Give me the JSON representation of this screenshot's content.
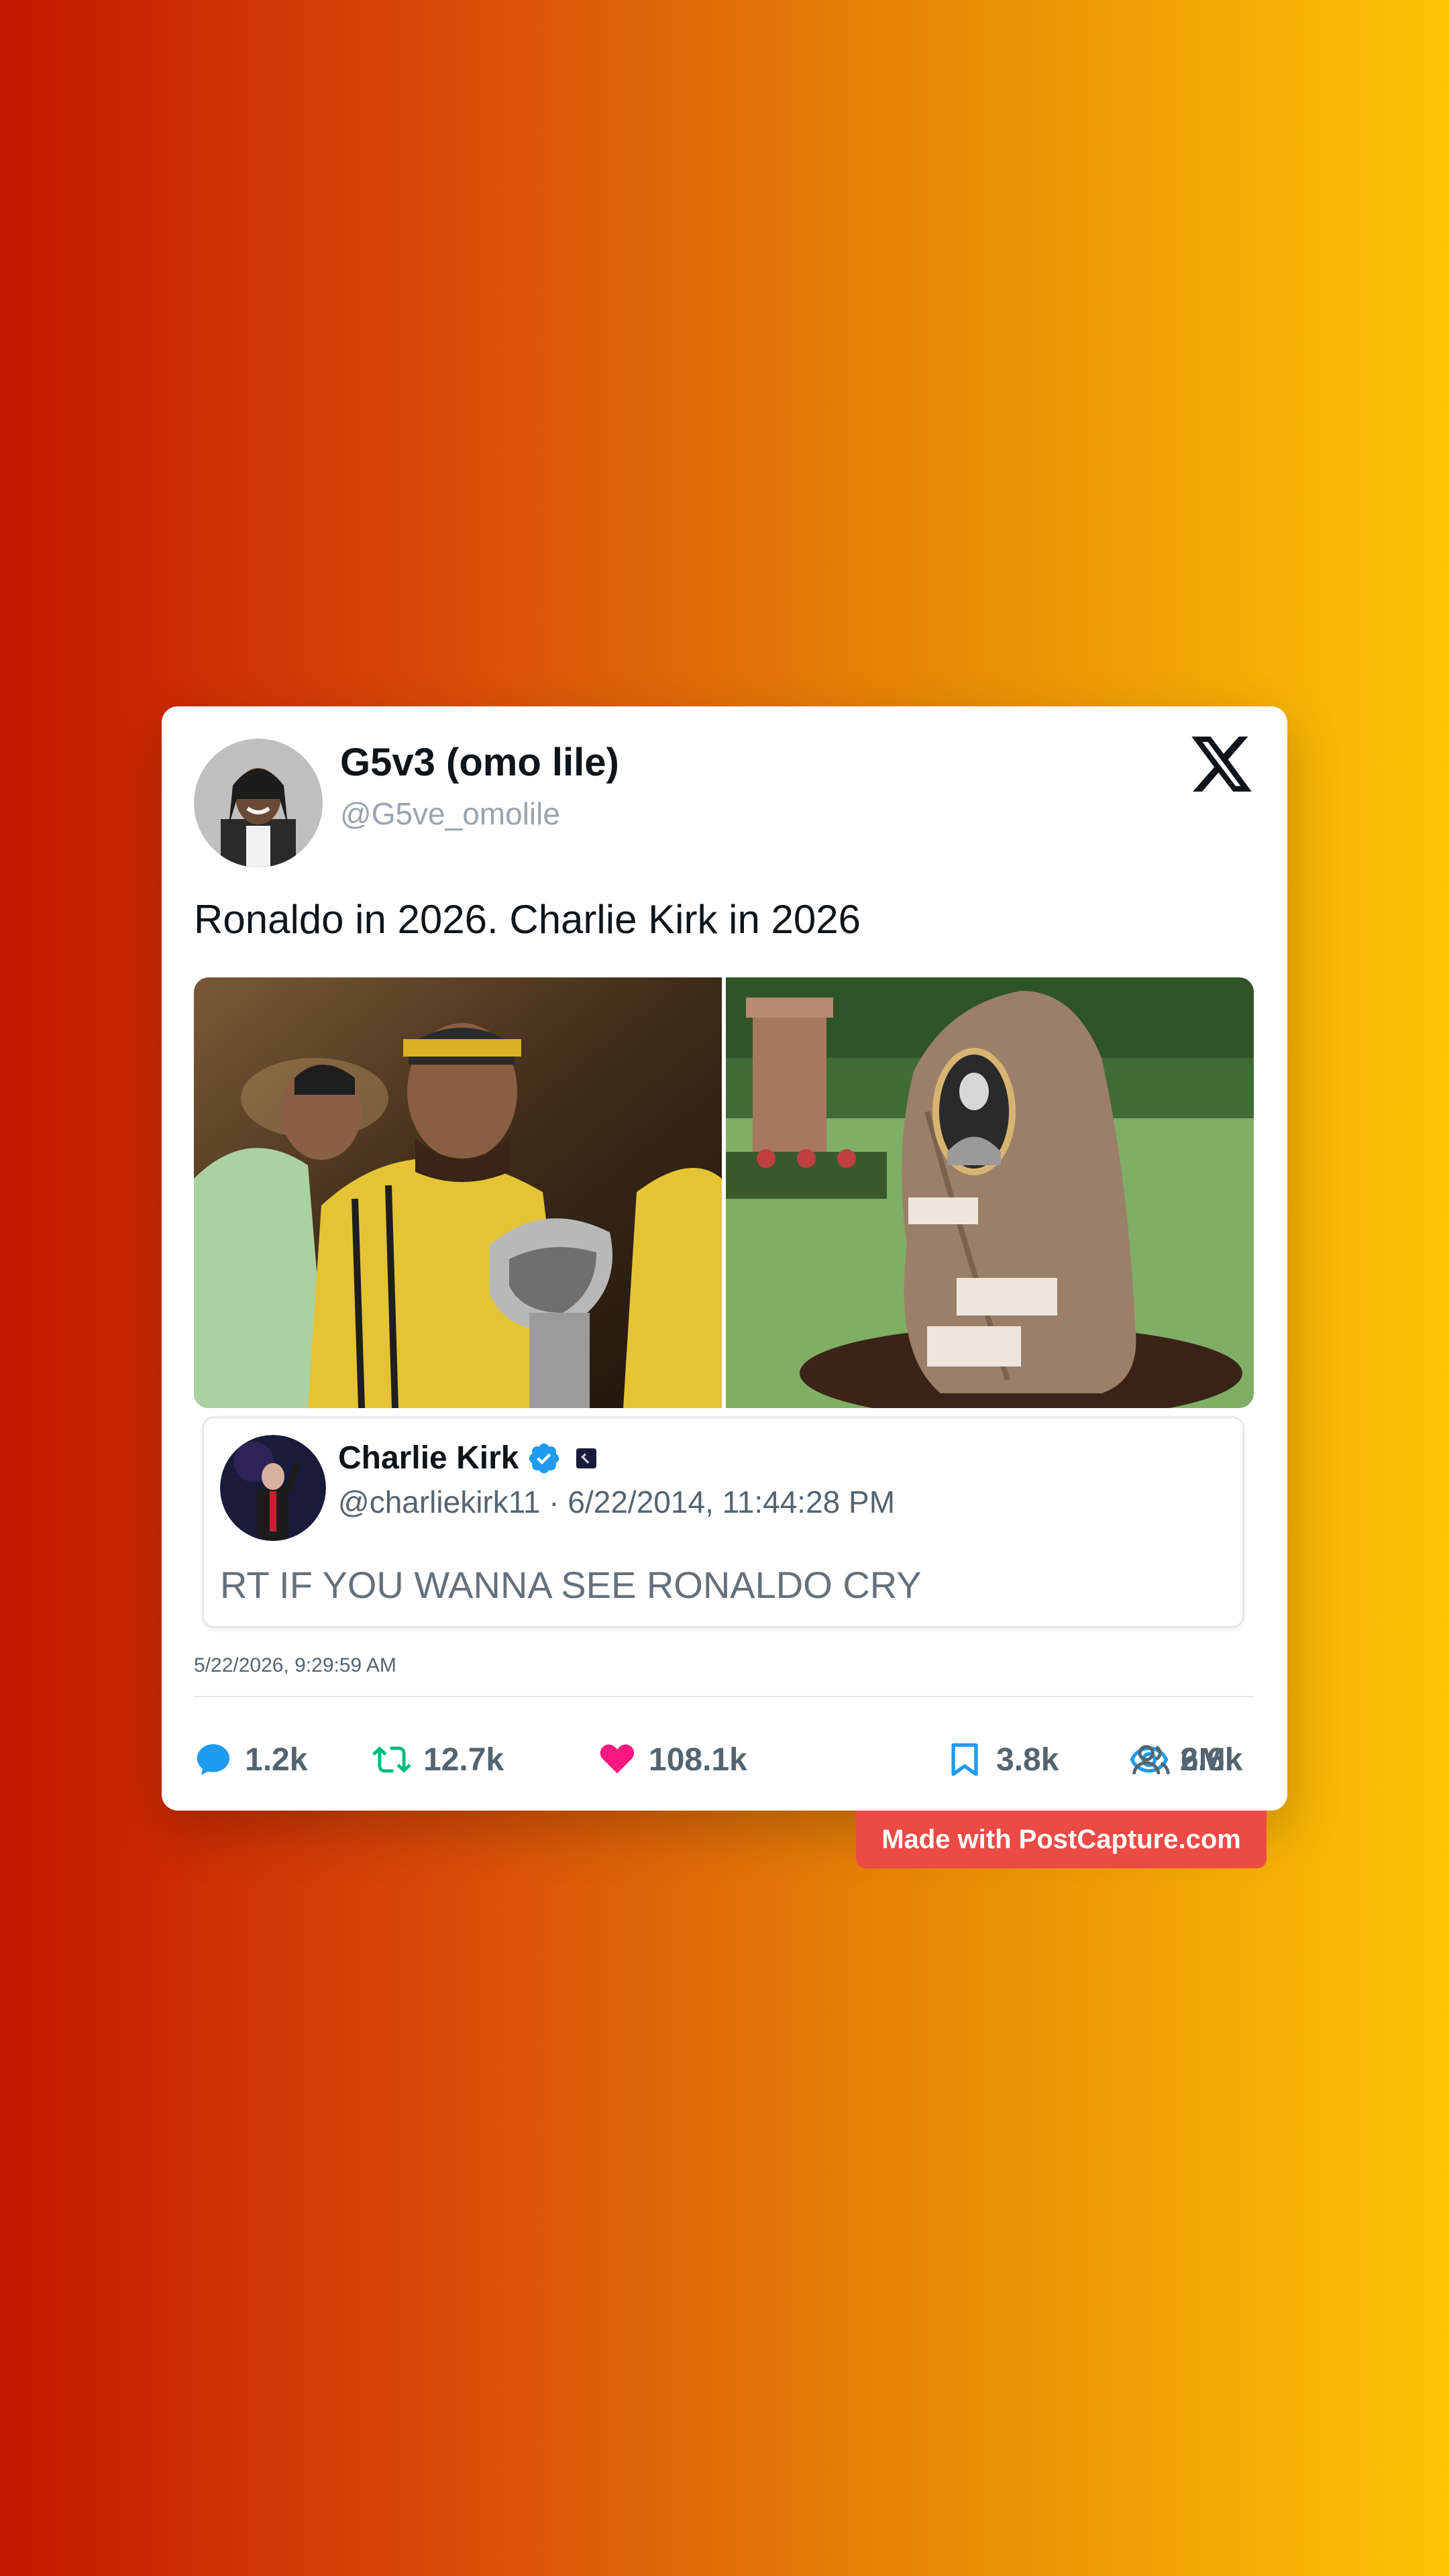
{
  "post": {
    "author": {
      "name": "G5v3 (omo lile)",
      "handle": "@G5ve_omolile"
    },
    "text": "Ronaldo in 2026. Charlie Kirk in 2026",
    "timestamp": "5/22/2026, 9:29:59 AM",
    "media": [
      {
        "description_icon": "photo"
      },
      {
        "description_icon": "photo"
      }
    ],
    "quoted": {
      "name": "Charlie Kirk",
      "handle": "@charliekirk11",
      "separator": "·",
      "date": "6/22/2014, 11:44:28 PM",
      "text": "RT IF YOU WANNA SEE RONALDO CRY"
    },
    "stats": {
      "replies": "1.2k",
      "reposts": "12.7k",
      "likes": "108.1k",
      "bookmarks": "3.8k",
      "views": "6M",
      "followers": "2.6k"
    }
  },
  "watermark": "Made with PostCapture.com",
  "colors": {
    "reply": "#1d9bf0",
    "repost": "#00ba7c",
    "like": "#f91880",
    "bookmark": "#1d9bf0",
    "views": "#1d9bf0",
    "badge": "#ec4a45"
  }
}
